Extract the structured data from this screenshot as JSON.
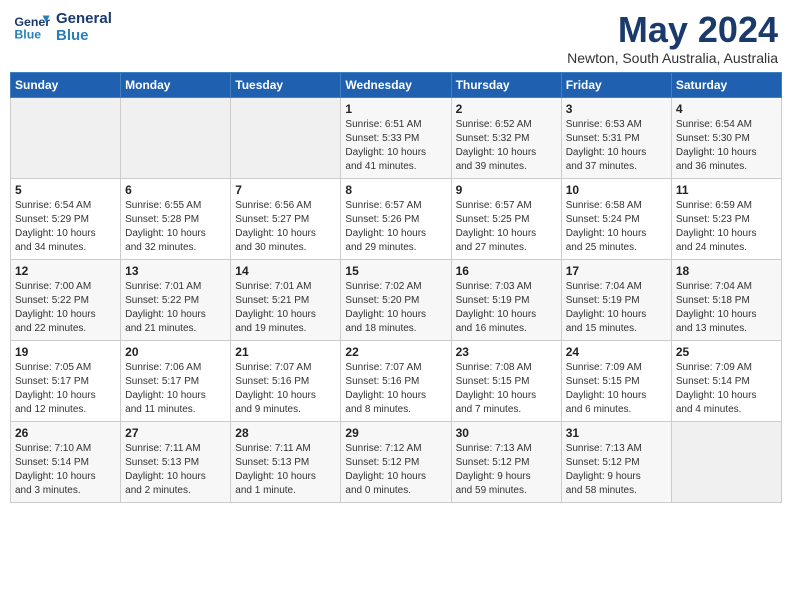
{
  "header": {
    "logo_line1": "General",
    "logo_line2": "Blue",
    "month_title": "May 2024",
    "location": "Newton, South Australia, Australia"
  },
  "weekdays": [
    "Sunday",
    "Monday",
    "Tuesday",
    "Wednesday",
    "Thursday",
    "Friday",
    "Saturday"
  ],
  "weeks": [
    [
      {
        "day": "",
        "info": ""
      },
      {
        "day": "",
        "info": ""
      },
      {
        "day": "",
        "info": ""
      },
      {
        "day": "1",
        "info": "Sunrise: 6:51 AM\nSunset: 5:33 PM\nDaylight: 10 hours\nand 41 minutes."
      },
      {
        "day": "2",
        "info": "Sunrise: 6:52 AM\nSunset: 5:32 PM\nDaylight: 10 hours\nand 39 minutes."
      },
      {
        "day": "3",
        "info": "Sunrise: 6:53 AM\nSunset: 5:31 PM\nDaylight: 10 hours\nand 37 minutes."
      },
      {
        "day": "4",
        "info": "Sunrise: 6:54 AM\nSunset: 5:30 PM\nDaylight: 10 hours\nand 36 minutes."
      }
    ],
    [
      {
        "day": "5",
        "info": "Sunrise: 6:54 AM\nSunset: 5:29 PM\nDaylight: 10 hours\nand 34 minutes."
      },
      {
        "day": "6",
        "info": "Sunrise: 6:55 AM\nSunset: 5:28 PM\nDaylight: 10 hours\nand 32 minutes."
      },
      {
        "day": "7",
        "info": "Sunrise: 6:56 AM\nSunset: 5:27 PM\nDaylight: 10 hours\nand 30 minutes."
      },
      {
        "day": "8",
        "info": "Sunrise: 6:57 AM\nSunset: 5:26 PM\nDaylight: 10 hours\nand 29 minutes."
      },
      {
        "day": "9",
        "info": "Sunrise: 6:57 AM\nSunset: 5:25 PM\nDaylight: 10 hours\nand 27 minutes."
      },
      {
        "day": "10",
        "info": "Sunrise: 6:58 AM\nSunset: 5:24 PM\nDaylight: 10 hours\nand 25 minutes."
      },
      {
        "day": "11",
        "info": "Sunrise: 6:59 AM\nSunset: 5:23 PM\nDaylight: 10 hours\nand 24 minutes."
      }
    ],
    [
      {
        "day": "12",
        "info": "Sunrise: 7:00 AM\nSunset: 5:22 PM\nDaylight: 10 hours\nand 22 minutes."
      },
      {
        "day": "13",
        "info": "Sunrise: 7:01 AM\nSunset: 5:22 PM\nDaylight: 10 hours\nand 21 minutes."
      },
      {
        "day": "14",
        "info": "Sunrise: 7:01 AM\nSunset: 5:21 PM\nDaylight: 10 hours\nand 19 minutes."
      },
      {
        "day": "15",
        "info": "Sunrise: 7:02 AM\nSunset: 5:20 PM\nDaylight: 10 hours\nand 18 minutes."
      },
      {
        "day": "16",
        "info": "Sunrise: 7:03 AM\nSunset: 5:19 PM\nDaylight: 10 hours\nand 16 minutes."
      },
      {
        "day": "17",
        "info": "Sunrise: 7:04 AM\nSunset: 5:19 PM\nDaylight: 10 hours\nand 15 minutes."
      },
      {
        "day": "18",
        "info": "Sunrise: 7:04 AM\nSunset: 5:18 PM\nDaylight: 10 hours\nand 13 minutes."
      }
    ],
    [
      {
        "day": "19",
        "info": "Sunrise: 7:05 AM\nSunset: 5:17 PM\nDaylight: 10 hours\nand 12 minutes."
      },
      {
        "day": "20",
        "info": "Sunrise: 7:06 AM\nSunset: 5:17 PM\nDaylight: 10 hours\nand 11 minutes."
      },
      {
        "day": "21",
        "info": "Sunrise: 7:07 AM\nSunset: 5:16 PM\nDaylight: 10 hours\nand 9 minutes."
      },
      {
        "day": "22",
        "info": "Sunrise: 7:07 AM\nSunset: 5:16 PM\nDaylight: 10 hours\nand 8 minutes."
      },
      {
        "day": "23",
        "info": "Sunrise: 7:08 AM\nSunset: 5:15 PM\nDaylight: 10 hours\nand 7 minutes."
      },
      {
        "day": "24",
        "info": "Sunrise: 7:09 AM\nSunset: 5:15 PM\nDaylight: 10 hours\nand 6 minutes."
      },
      {
        "day": "25",
        "info": "Sunrise: 7:09 AM\nSunset: 5:14 PM\nDaylight: 10 hours\nand 4 minutes."
      }
    ],
    [
      {
        "day": "26",
        "info": "Sunrise: 7:10 AM\nSunset: 5:14 PM\nDaylight: 10 hours\nand 3 minutes."
      },
      {
        "day": "27",
        "info": "Sunrise: 7:11 AM\nSunset: 5:13 PM\nDaylight: 10 hours\nand 2 minutes."
      },
      {
        "day": "28",
        "info": "Sunrise: 7:11 AM\nSunset: 5:13 PM\nDaylight: 10 hours\nand 1 minute."
      },
      {
        "day": "29",
        "info": "Sunrise: 7:12 AM\nSunset: 5:12 PM\nDaylight: 10 hours\nand 0 minutes."
      },
      {
        "day": "30",
        "info": "Sunrise: 7:13 AM\nSunset: 5:12 PM\nDaylight: 9 hours\nand 59 minutes."
      },
      {
        "day": "31",
        "info": "Sunrise: 7:13 AM\nSunset: 5:12 PM\nDaylight: 9 hours\nand 58 minutes."
      },
      {
        "day": "",
        "info": ""
      }
    ]
  ]
}
